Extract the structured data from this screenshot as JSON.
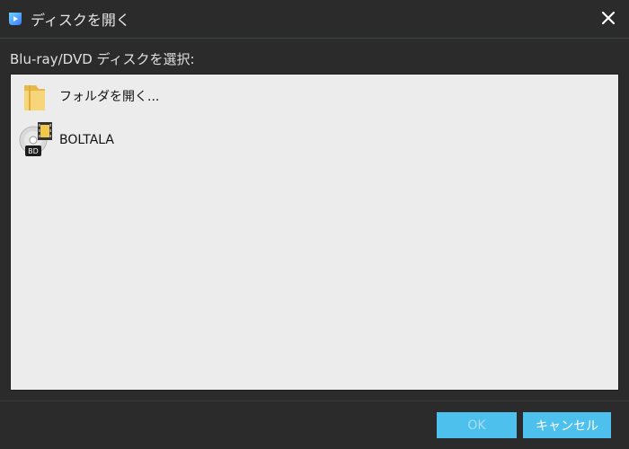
{
  "window": {
    "title": "ディスクを開く"
  },
  "prompt": "Blu-ray/DVD ディスクを選択:",
  "items": [
    {
      "label": "フォルダを開く...",
      "icon": "folder-icon"
    },
    {
      "label": "BOLTALA",
      "icon": "bluray-disc-icon",
      "badge": "BD"
    }
  ],
  "buttons": {
    "ok_label": "OK",
    "cancel_label": "キャンセル"
  },
  "colors": {
    "background": "#2b2b2b",
    "list_background": "#ececec",
    "accent": "#4ec0ee"
  }
}
